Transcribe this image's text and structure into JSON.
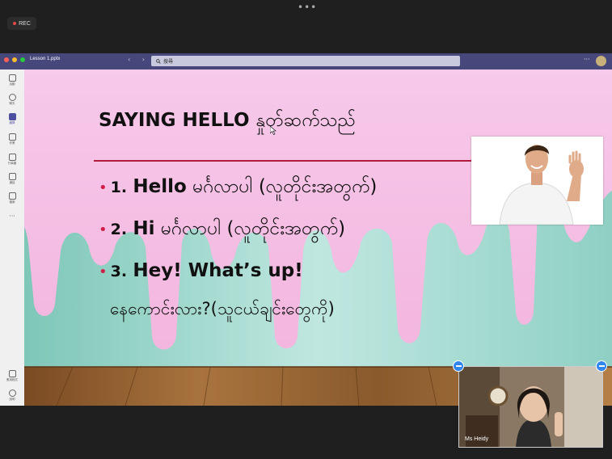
{
  "recording": {
    "label": "REC"
  },
  "top_menu": {
    "more": "•••"
  },
  "window": {
    "title": "Lesson 1.pptx",
    "search_placeholder": "搜尋",
    "more": "···",
    "nav": "‹ ›"
  },
  "sidebar": {
    "items": [
      {
        "label": "活動",
        "icon": "bell-icon"
      },
      {
        "label": "聊天",
        "icon": "chat-icon"
      },
      {
        "label": "團隊",
        "icon": "teams-icon",
        "active": true
      },
      {
        "label": "作業",
        "icon": "assignments-icon"
      },
      {
        "label": "行事曆",
        "icon": "calendar-icon"
      },
      {
        "label": "通話",
        "icon": "phone-icon"
      },
      {
        "label": "檔案",
        "icon": "file-icon"
      },
      {
        "label": "···",
        "icon": "more-icon"
      }
    ],
    "bottom": [
      {
        "label": "應用程式",
        "icon": "apps-icon"
      },
      {
        "label": "說明",
        "icon": "help-icon"
      }
    ]
  },
  "slide": {
    "title_en": "SAYING HELLO",
    "title_my": "နှုတ်ဆက်သည်",
    "bullets": [
      {
        "num": "1.",
        "en": "Hello",
        "my": "မင်္ဂလာပါ (လူတိုင်းအတွက်)"
      },
      {
        "num": "2.",
        "en": "Hi",
        "my": "မင်္ဂလာပါ (လူတိုင်းအတွက်)"
      },
      {
        "num": "3.",
        "en": "Hey! What’s up!",
        "my": "နေကောင်းလား?(သူငယ်ချင်းတွေကို)"
      }
    ]
  },
  "self_video": {
    "name": "Ms Heidy"
  },
  "colors": {
    "titlebar": "#46477a",
    "accent": "#4d4fa0",
    "slide_divider": "#b21c3c",
    "circle_button": "#2f86f0"
  }
}
